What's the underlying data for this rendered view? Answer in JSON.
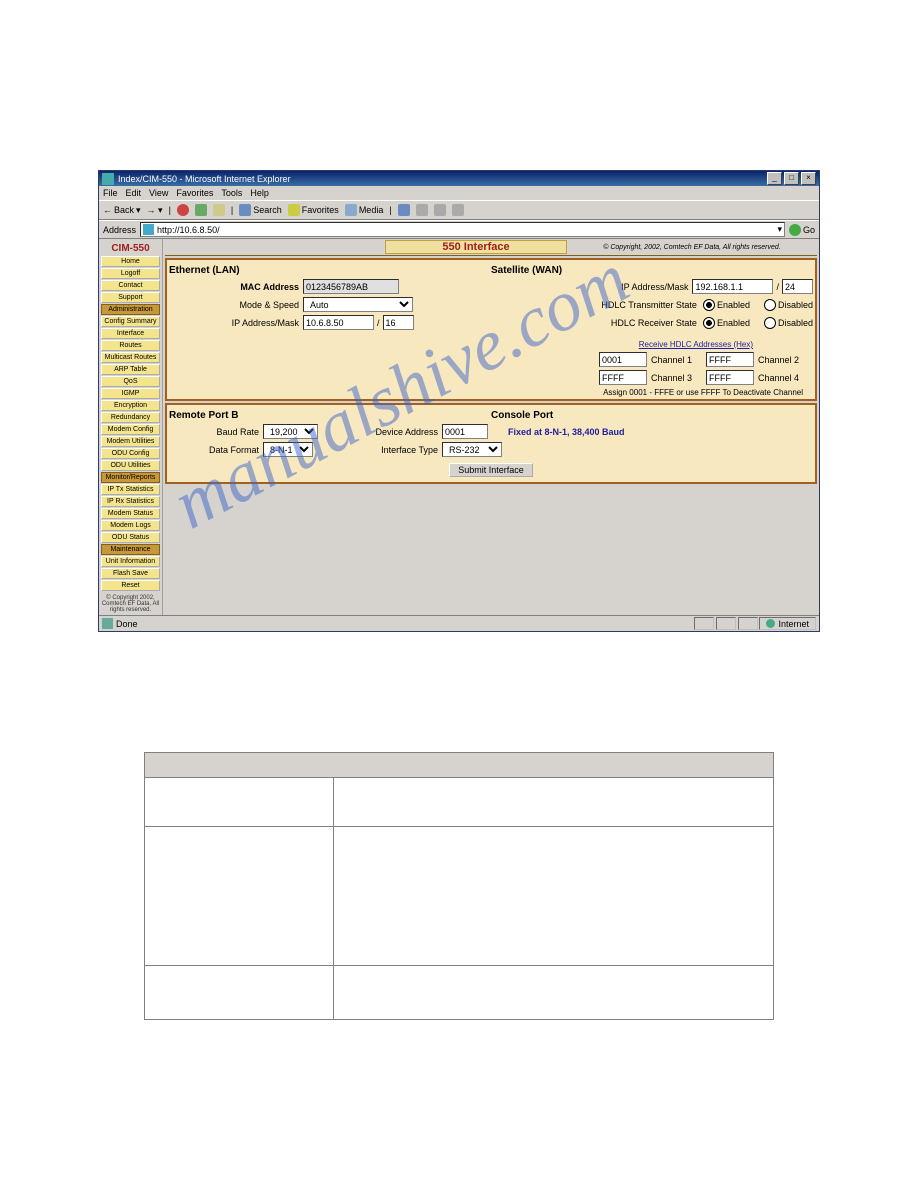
{
  "titlebar": {
    "text": "Index/CIM-550 - Microsoft Internet Explorer"
  },
  "menubar": [
    "File",
    "Edit",
    "View",
    "Favorites",
    "Tools",
    "Help"
  ],
  "toolbar": {
    "back": "Back",
    "forward": "",
    "stop": "",
    "refresh": "",
    "home": "",
    "search": "Search",
    "favorites": "Favorites",
    "media": "Media"
  },
  "addrbar": {
    "label": "Address",
    "value": "http://10.6.8.50/",
    "go": "Go"
  },
  "sidebar": {
    "title": "CIM-550",
    "groups": [
      {
        "head": "",
        "items": [
          "Home",
          "Logoff",
          "Contact",
          "Support"
        ]
      },
      {
        "head": "Administration",
        "items": [
          "Config Summary"
        ]
      },
      {
        "head": "",
        "items": [
          "Interface",
          "Routes",
          "Multicast Routes",
          "ARP Table",
          "QoS",
          "IGMP",
          "Encryption",
          "Redundancy",
          "Modem Config",
          "Modem Utilities",
          "ODU Config",
          "ODU Utilities"
        ]
      },
      {
        "head": "Monitor/Reports",
        "items": [
          "IP Tx Statistics",
          "IP Rx Statistics",
          "Modem Status",
          "Modem Logs",
          "ODU Status"
        ]
      },
      {
        "head": "Maintenance",
        "items": [
          "Unit Information",
          "Flash Save",
          "Reset"
        ]
      }
    ],
    "foot": "© Copyright 2002,\nComtech EF Data, All\nrights reserved."
  },
  "header": {
    "title": "550 Interface",
    "copy": "© Copyright, 2002, Comtech EF Data, All rights reserved."
  },
  "ethernet": {
    "title": "Ethernet (LAN)",
    "mac_label": "MAC Address",
    "mac_value": "0123456789AB",
    "mode_label": "Mode & Speed",
    "mode_value": "Auto",
    "ip_label": "IP Address/Mask",
    "ip_value": "10.6.8.50",
    "mask_value": "16"
  },
  "satellite": {
    "title": "Satellite (WAN)",
    "ip_label": "IP Address/Mask",
    "ip_value": "192.168.1.1",
    "mask_value": "24",
    "tx_label": "HDLC Transmitter State",
    "tx_enabled": true,
    "rx_label": "HDLC Receiver State",
    "rx_enabled": true,
    "enabled": "Enabled",
    "disabled": "Disabled",
    "rcv_label": "Receive HDLC Addresses (Hex)",
    "ch": [
      {
        "val": "0001",
        "lbl": "Channel 1"
      },
      {
        "val": "FFFF",
        "lbl": "Channel 2"
      },
      {
        "val": "FFFF",
        "lbl": "Channel 3"
      },
      {
        "val": "FFFF",
        "lbl": "Channel 4"
      }
    ],
    "instr": "Assign 0001 - FFFE or use FFFF To Deactivate Channel"
  },
  "remote": {
    "title": "Remote Port B",
    "baud_label": "Baud Rate",
    "baud_value": "19,200",
    "data_label": "Data Format",
    "data_value": "8-N-1",
    "dev_label": "Device Address",
    "dev_value": "0001",
    "iface_label": "Interface Type",
    "iface_value": "RS-232"
  },
  "console": {
    "title": "Console Port",
    "text": "Fixed at 8-N-1, 38,400 Baud"
  },
  "submit": "Submit Interface",
  "statusbar": {
    "done": "Done",
    "zone": "Internet"
  },
  "watermark": "manualshive.com"
}
